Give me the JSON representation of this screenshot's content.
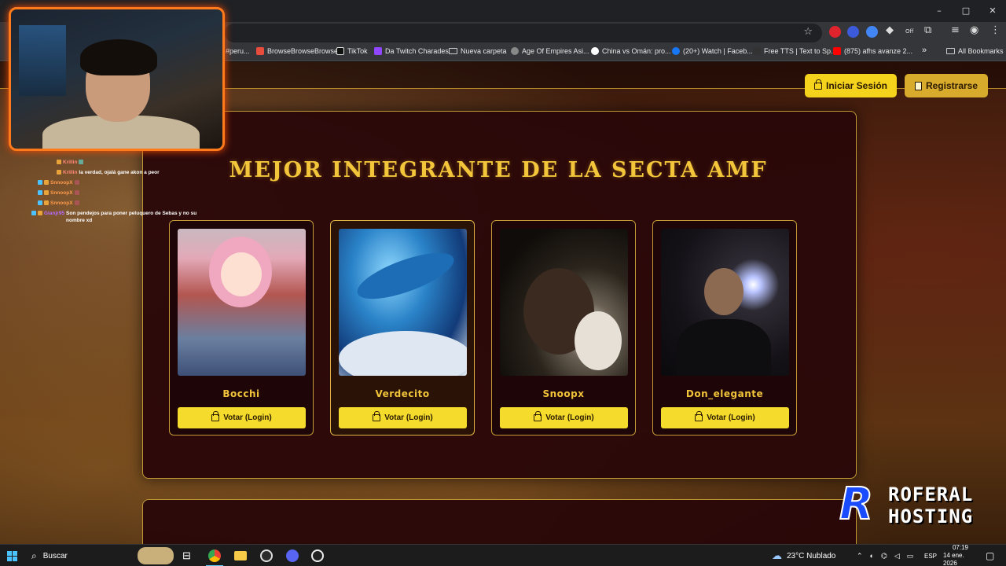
{
  "browser": {
    "window_controls": [
      "–",
      "□",
      "✕"
    ],
    "extensions": {
      "off_label": "Off"
    },
    "bookmarks": [
      {
        "label": "#peru...",
        "color": "#555"
      },
      {
        "label": "BrowseBrowseBrowse",
        "color": "#e84c3d"
      },
      {
        "label": "TikTok",
        "color": "#111"
      },
      {
        "label": "Da Twitch Charades",
        "color": "#9146ff"
      },
      {
        "label": "Nueva carpeta",
        "color": "folder"
      },
      {
        "label": "Age Of Empires Asi...",
        "color": "#888"
      },
      {
        "label": "China vs Omán: pro...",
        "color": "#fff"
      },
      {
        "label": "(20+) Watch | Faceb...",
        "color": "#1877f2"
      },
      {
        "label": "Free TTS | Text to Sp...",
        "color": "#333"
      },
      {
        "label": "(875) afhs avanze 2...",
        "color": "#ff0000"
      }
    ],
    "more_bookmarks": "»",
    "all_bookmarks": "All Bookmarks"
  },
  "header": {
    "login_label": "Iniciar Sesión",
    "register_label": "Registrarse"
  },
  "main": {
    "title": "MEJOR INTEGRANTE DE LA SECTA AMF",
    "cards": [
      {
        "name": "Bocchi",
        "vote_label": "Votar (Login)"
      },
      {
        "name": "Verdecito",
        "vote_label": "Votar (Login)"
      },
      {
        "name": "Snoopx",
        "vote_label": "Votar (Login)"
      },
      {
        "name": "Don_elegante",
        "vote_label": "Votar (Login)"
      }
    ]
  },
  "chat": [
    {
      "user": "Krillin",
      "msg": "",
      "color": "#ff6b6b"
    },
    {
      "user": "Krillin",
      "msg": "la verdad, ojalá gane akon a peor",
      "color": "#ff6b6b"
    },
    {
      "user": "SnnoopX",
      "msg": "",
      "color": "#ff8a3d"
    },
    {
      "user": "SnnoopX",
      "msg": "",
      "color": "#ff8a3d"
    },
    {
      "user": "SnnoopX",
      "msg": "",
      "color": "#ff8a3d"
    },
    {
      "user": "Gianjr95",
      "msg": "Son pendejos para poner peluquero de Sebas y no su nombre xd",
      "color": "#b76cff"
    }
  ],
  "overlay_logo": {
    "r": "R",
    "line1": "ROFERAL",
    "line2": "HOSTING"
  },
  "taskbar": {
    "search_label": "Buscar",
    "weather": "23°C  Nublado",
    "language": "ESP",
    "time": "07:19",
    "date": "14 ene. 2026"
  }
}
